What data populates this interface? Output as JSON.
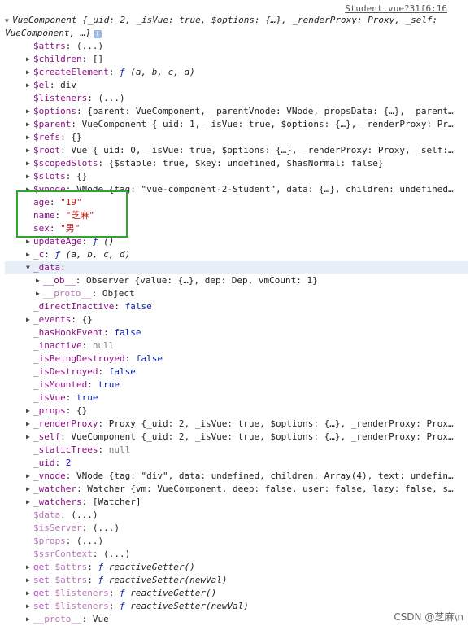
{
  "source_link": "Student.vue?31f6:16",
  "root_line_1": "VueComponent {_uid: 2, _isVue: true, $options: {…}, _renderProxy: Proxy, _self:",
  "root_line_2": "VueComponent, …}",
  "info_icon": "i",
  "watermark": "CSDN @芝麻\\n",
  "rows": [
    {
      "expandable": false,
      "key": "$attrs",
      "style": "own",
      "value": "(...)"
    },
    {
      "expandable": true,
      "key": "$children",
      "style": "own",
      "value": "[]"
    },
    {
      "expandable": true,
      "key": "$createElement",
      "style": "own",
      "value": "ƒ (a, b, c, d)"
    },
    {
      "expandable": true,
      "key": "$el",
      "style": "own",
      "value": "div"
    },
    {
      "expandable": false,
      "key": "$listeners",
      "style": "own",
      "value": "(...)"
    },
    {
      "expandable": true,
      "key": "$options",
      "style": "own",
      "value": "{parent: VueComponent, _parentVnode: VNode, propsData: {…}, _parent…"
    },
    {
      "expandable": true,
      "key": "$parent",
      "style": "own",
      "value": "VueComponent {_uid: 1, _isVue: true, $options: {…}, _renderProxy: Pr…"
    },
    {
      "expandable": true,
      "key": "$refs",
      "style": "own",
      "value": "{}"
    },
    {
      "expandable": true,
      "key": "$root",
      "style": "own",
      "value": "Vue {_uid: 0, _isVue: true, $options: {…}, _renderProxy: Proxy, _self:…"
    },
    {
      "expandable": true,
      "key": "$scopedSlots",
      "style": "own",
      "value": "{$stable: true, $key: undefined, $hasNormal: false}"
    },
    {
      "expandable": true,
      "key": "$slots",
      "style": "own",
      "value": "{}"
    },
    {
      "expandable": true,
      "key": "$vnode",
      "style": "own",
      "value": "VNode {tag: \"vue-component-2-Student\", data: {…}, children: undefined…"
    },
    {
      "expandable": false,
      "key": "age",
      "style": "own",
      "value": "\"19\""
    },
    {
      "expandable": false,
      "key": "name",
      "style": "own",
      "value": "\"芝麻\""
    },
    {
      "expandable": false,
      "key": "sex",
      "style": "own",
      "value": "\"男\""
    },
    {
      "expandable": true,
      "key": "updateAge",
      "style": "own",
      "value": "ƒ ()"
    },
    {
      "expandable": true,
      "key": "_c",
      "style": "own",
      "value": "ƒ (a, b, c, d)"
    },
    {
      "expandable": true,
      "expanded": true,
      "key": "_data",
      "style": "own",
      "value": ""
    },
    {
      "expandable": true,
      "indent": 1,
      "key": "__ob__",
      "style": "own",
      "value": "Observer {value: {…}, dep: Dep, vmCount: 1}"
    },
    {
      "expandable": true,
      "indent": 1,
      "key": "__proto__",
      "style": "proto",
      "value": "Object"
    },
    {
      "expandable": false,
      "key": "_directInactive",
      "style": "own",
      "value": "false"
    },
    {
      "expandable": true,
      "key": "_events",
      "style": "own",
      "value": "{}"
    },
    {
      "expandable": false,
      "key": "_hasHookEvent",
      "style": "own",
      "value": "false"
    },
    {
      "expandable": false,
      "key": "_inactive",
      "style": "own",
      "value": "null"
    },
    {
      "expandable": false,
      "key": "_isBeingDestroyed",
      "style": "own",
      "value": "false"
    },
    {
      "expandable": false,
      "key": "_isDestroyed",
      "style": "own",
      "value": "false"
    },
    {
      "expandable": false,
      "key": "_isMounted",
      "style": "own",
      "value": "true"
    },
    {
      "expandable": false,
      "key": "_isVue",
      "style": "own",
      "value": "true"
    },
    {
      "expandable": true,
      "key": "_props",
      "style": "own",
      "value": "{}"
    },
    {
      "expandable": true,
      "key": "_renderProxy",
      "style": "own",
      "value": "Proxy {_uid: 2, _isVue: true, $options: {…}, _renderProxy: Prox…"
    },
    {
      "expandable": true,
      "key": "_self",
      "style": "own",
      "value": "VueComponent {_uid: 2, _isVue: true, $options: {…}, _renderProxy: Prox…"
    },
    {
      "expandable": false,
      "key": "_staticTrees",
      "style": "own",
      "value": "null"
    },
    {
      "expandable": false,
      "key": "_uid",
      "style": "own",
      "value": "2"
    },
    {
      "expandable": true,
      "key": "_vnode",
      "style": "own",
      "value": "VNode {tag: \"div\", data: undefined, children: Array(4), text: undefin…"
    },
    {
      "expandable": true,
      "key": "_watcher",
      "style": "own",
      "value": "Watcher {vm: VueComponent, deep: false, user: false, lazy: false, s…"
    },
    {
      "expandable": true,
      "key": "_watchers",
      "style": "own",
      "value": "[Watcher]"
    },
    {
      "expandable": false,
      "key": "$data",
      "style": "dim",
      "value": "(...)"
    },
    {
      "expandable": false,
      "key": "$isServer",
      "style": "dim",
      "value": "(...)"
    },
    {
      "expandable": false,
      "key": "$props",
      "style": "dim",
      "value": "(...)"
    },
    {
      "expandable": false,
      "key": "$ssrContext",
      "style": "dim",
      "value": "(...)"
    },
    {
      "expandable": true,
      "key": "get $attrs",
      "style": "dim",
      "value": "ƒ reactiveGetter()"
    },
    {
      "expandable": true,
      "key": "set $attrs",
      "style": "dim",
      "value": "ƒ reactiveSetter(newVal)"
    },
    {
      "expandable": true,
      "key": "get $listeners",
      "style": "dim",
      "value": "ƒ reactiveGetter()"
    },
    {
      "expandable": true,
      "key": "set $listeners",
      "style": "dim",
      "value": "ƒ reactiveSetter(newVal)"
    },
    {
      "expandable": true,
      "key": "__proto__",
      "style": "proto",
      "value": "Vue"
    }
  ]
}
